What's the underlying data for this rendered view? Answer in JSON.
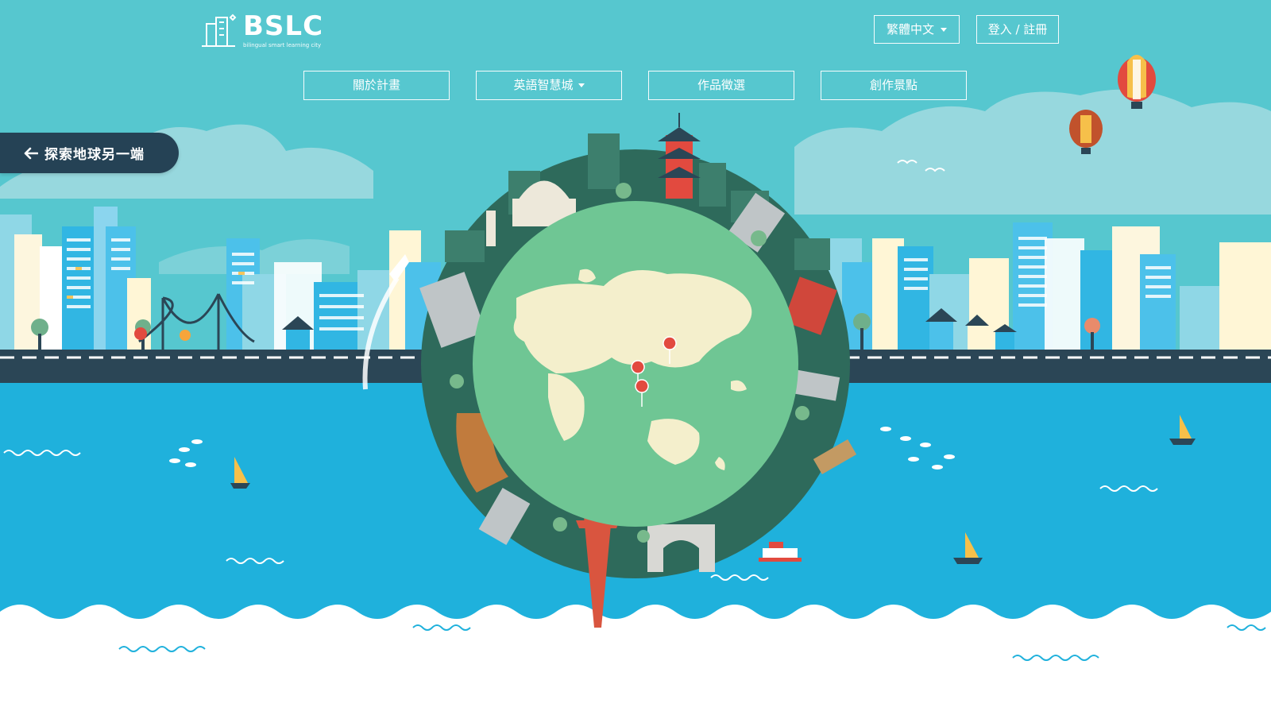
{
  "brand": {
    "name": "BSLC",
    "tagline": "bilingual smart learning city"
  },
  "header": {
    "language_label": "繁體中文",
    "login_label": "登入 / 註冊"
  },
  "nav": {
    "items": [
      {
        "label": "關於計畫",
        "has_dropdown": false
      },
      {
        "label": "英語智慧城",
        "has_dropdown": true
      },
      {
        "label": "作品徵選",
        "has_dropdown": false
      },
      {
        "label": "創作景點",
        "has_dropdown": false
      }
    ]
  },
  "explore": {
    "label": "探索地球另一端",
    "icon": "arrow-left-icon"
  },
  "colors": {
    "sky": "#56c7cf",
    "sea": "#1fb1dc",
    "road": "#2b4656",
    "globe_land": "#f4efcc",
    "globe_ocean": "#6fc694",
    "pin": "#e24a3f",
    "explore_bg": "#254255"
  }
}
